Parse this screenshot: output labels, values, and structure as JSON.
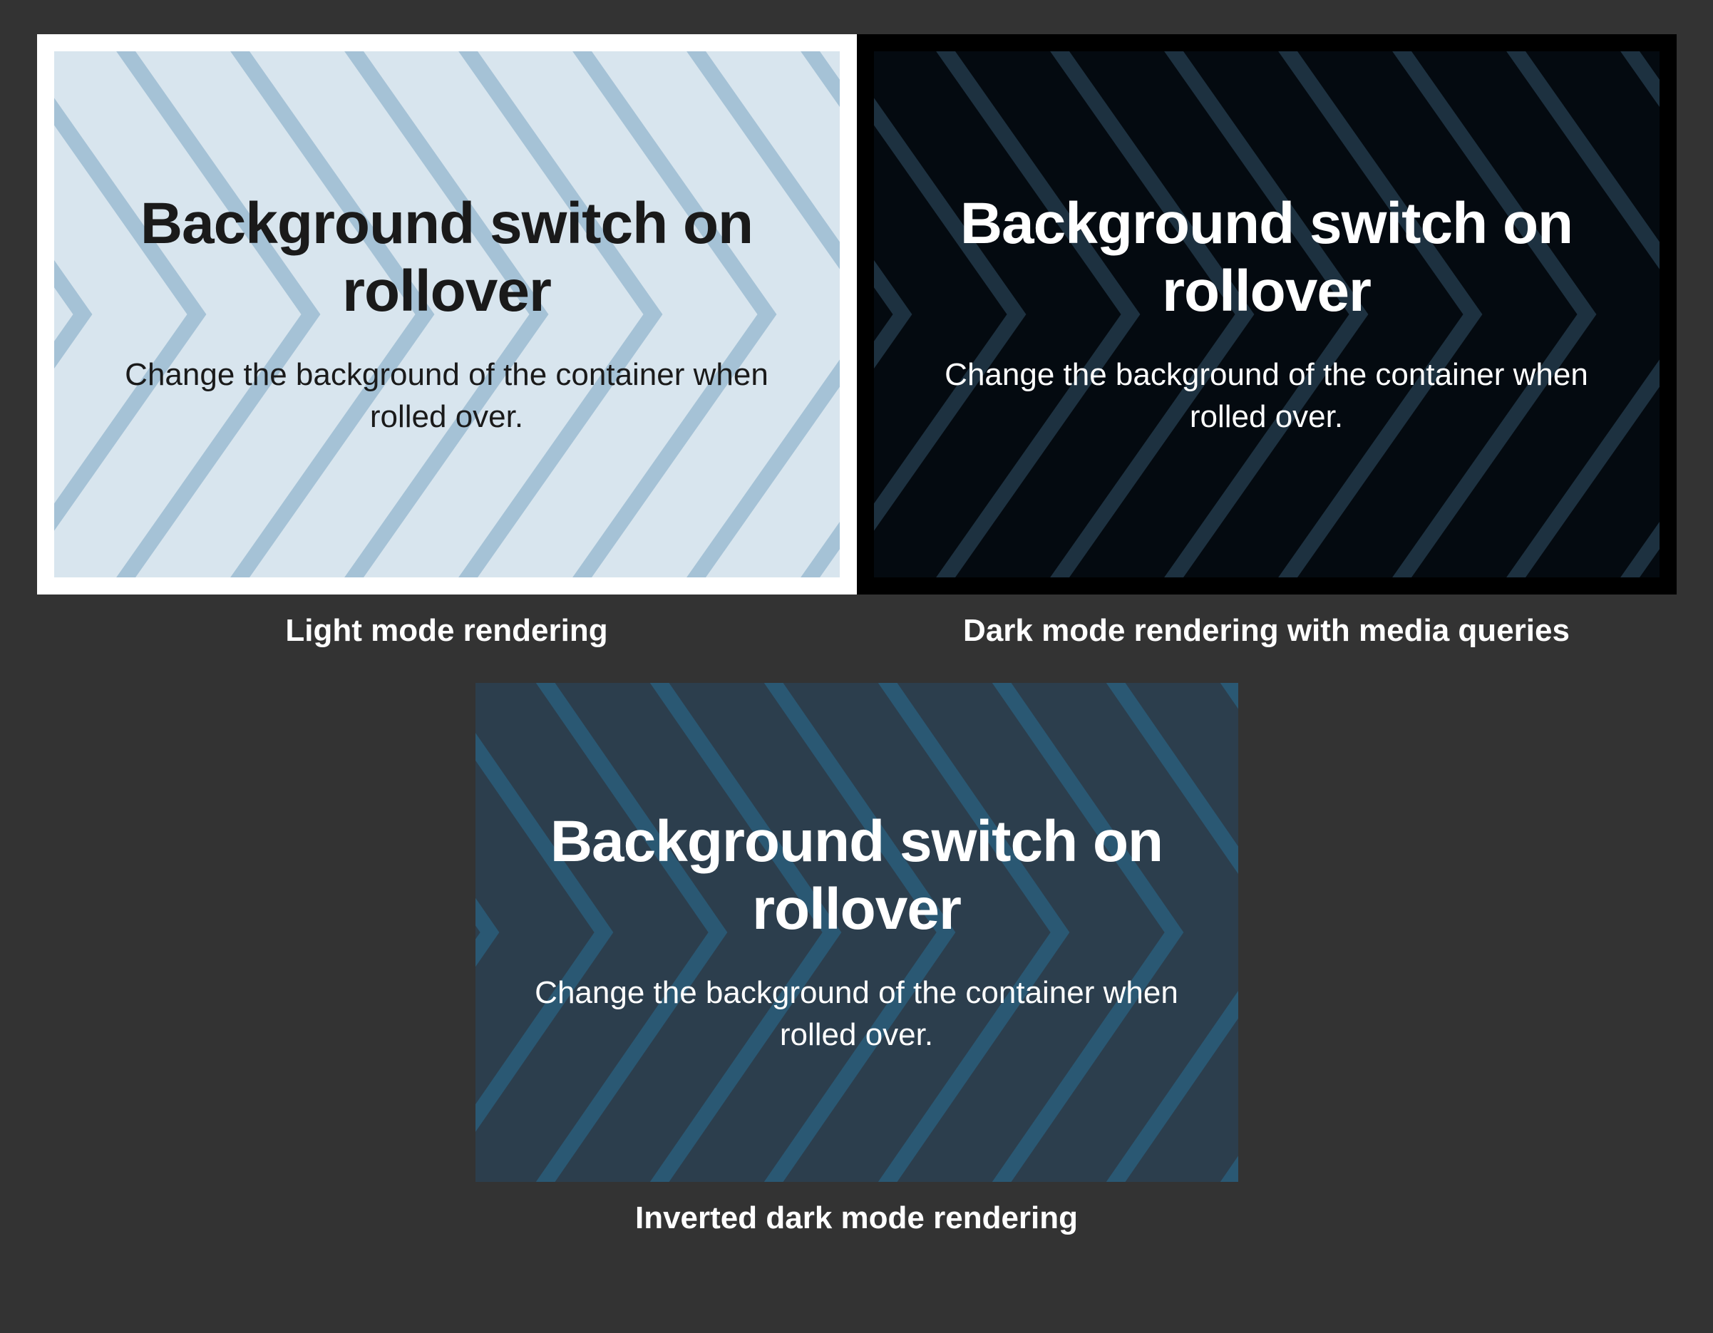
{
  "panels": {
    "light": {
      "heading": "Background switch on rollover",
      "body": "Change the background of the container when rolled over.",
      "caption": "Light mode rendering"
    },
    "dark": {
      "heading": "Background switch on rollover",
      "body": "Change the background of the container when rolled over.",
      "caption": "Dark mode rendering with media queries"
    },
    "inverted": {
      "heading": "Background switch on rollover",
      "body": "Change the background of the container when rolled over.",
      "caption": "Inverted dark mode rendering"
    }
  },
  "colors": {
    "page_bg": "#333333",
    "light_frame": "#ffffff",
    "light_card_bg": "#d8e5ee",
    "light_stripe": "#a5c2d6",
    "light_text": "#1a1a1a",
    "dark_frame": "#000000",
    "dark_card_bg": "#040a10",
    "dark_stripe": "#1d3140",
    "dark_text": "#ffffff",
    "inverted_card_bg": "#2c3e4d",
    "inverted_stripe": "#2a5873",
    "inverted_text": "#ffffff"
  }
}
